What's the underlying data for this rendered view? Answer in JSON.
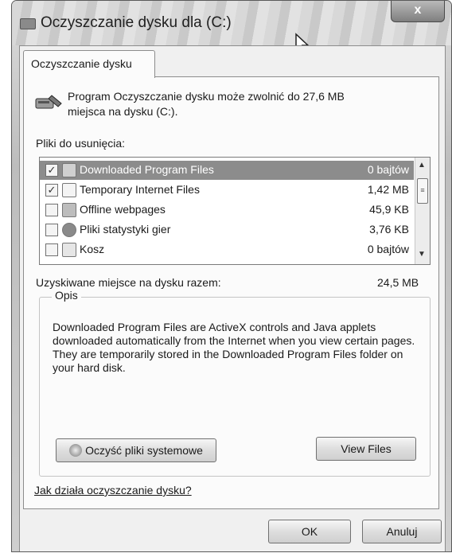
{
  "window": {
    "title": "Oczyszczanie dysku dla  (C:)",
    "close_label": "x"
  },
  "tab": {
    "label": "Oczyszczanie dysku"
  },
  "intro": {
    "line1": "Program Oczyszczanie dysku może zwolnić do 27,6 MB",
    "line2": "miejsca na dysku  (C:)."
  },
  "files_label": "Pliki do usunięcia:",
  "files": [
    {
      "name": "Downloaded Program Files",
      "size": "0 bajtów",
      "checked": true,
      "selected": true
    },
    {
      "name": "Temporary Internet Files",
      "size": "1,42 MB",
      "checked": true,
      "selected": false
    },
    {
      "name": "Offline webpages",
      "size": "45,9 KB",
      "checked": false,
      "selected": false
    },
    {
      "name": "Pliki statystyki gier",
      "size": "3,76 KB",
      "checked": false,
      "selected": false
    },
    {
      "name": "Kosz",
      "size": "0 bajtów",
      "checked": false,
      "selected": false
    }
  ],
  "total": {
    "label": "Uzyskiwane miejsce na dysku razem:",
    "value": "24,5 MB"
  },
  "description": {
    "title": "Opis",
    "text": "Downloaded Program Files are ActiveX controls and Java applets downloaded automatically from the Internet when you view certain pages. They are temporarily stored in the Downloaded Program Files folder on your hard disk."
  },
  "buttons": {
    "cleanup_system": "Oczyść pliki systemowe",
    "view_files": "View Files",
    "ok": "OK",
    "cancel": "Anuluj"
  },
  "help_link": "Jak działa oczyszczanie dysku?"
}
